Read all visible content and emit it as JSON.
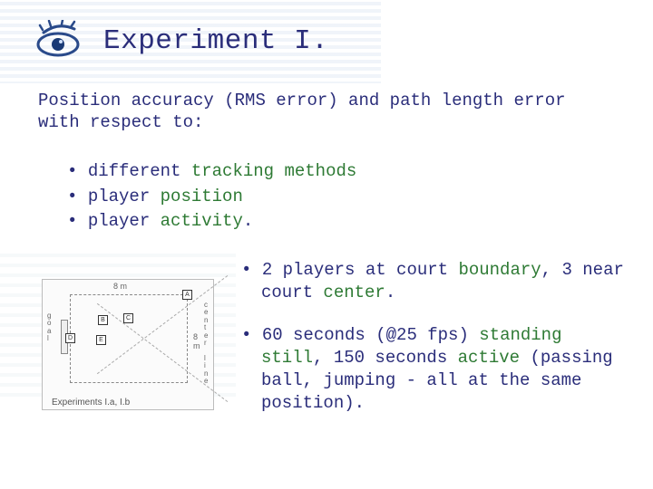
{
  "title": "Experiment I.",
  "intro": "Position accuracy (RMS error) and path length error with respect to:",
  "bullets_top": [
    {
      "prefix": "different ",
      "green1": "tracking",
      "mid": " ",
      "green2": "methods",
      "suffix": ""
    },
    {
      "prefix": "player ",
      "green1": "position",
      "mid": "",
      "green2": "",
      "suffix": ""
    },
    {
      "prefix": "player ",
      "green1": "activity",
      "mid": "",
      "green2": "",
      "suffix": "."
    }
  ],
  "diagram": {
    "goal_label": "g\no\na\nl",
    "center_label": "c\ne\nn\nt\ne\nr\n \nl\ni\nn\ne",
    "dim_h": "8 m",
    "dim_v": "8 m",
    "markers": [
      "A",
      "B",
      "C",
      "D",
      "E"
    ],
    "caption": "Experiments I.a, I.b"
  },
  "bullets_right": [
    {
      "pre": "2 players at court ",
      "g1": "boundary",
      "mid": ", 3 near court ",
      "g2": "center",
      "post": "."
    },
    {
      "pre": "60 seconds (@25 fps) ",
      "g1": "standing still",
      "mid": ", 150 seconds ",
      "g2": "active",
      "post": " (passing ball, jumping - all at the same position)."
    }
  ]
}
